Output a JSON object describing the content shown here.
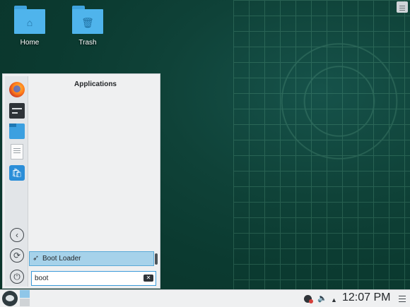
{
  "desktop": {
    "icons": [
      {
        "label": "Home",
        "icon": "home-folder-icon"
      },
      {
        "label": "Trash",
        "icon": "trash-folder-icon"
      }
    ]
  },
  "launcher": {
    "title": "Applications",
    "favorites": [
      "firefox-icon",
      "terminal-icon",
      "file-manager-icon",
      "text-editor-icon",
      "software-store-icon"
    ],
    "results": [
      {
        "label": "Boot Loader",
        "icon": "boot-loader-icon"
      }
    ],
    "search": {
      "value": "boot"
    },
    "sidebar_actions": [
      "back-icon",
      "refresh-icon",
      "power-icon"
    ]
  },
  "taskbar": {
    "clock": "12:07 PM",
    "tray": [
      "network-icon",
      "volume-icon",
      "arrow-up-icon",
      "menu-icon"
    ]
  },
  "colors": {
    "desktop": "#0b3a30",
    "accent": "#3a9ad9",
    "selection": "#a6d2ea",
    "folder": "#4fb4ec"
  }
}
